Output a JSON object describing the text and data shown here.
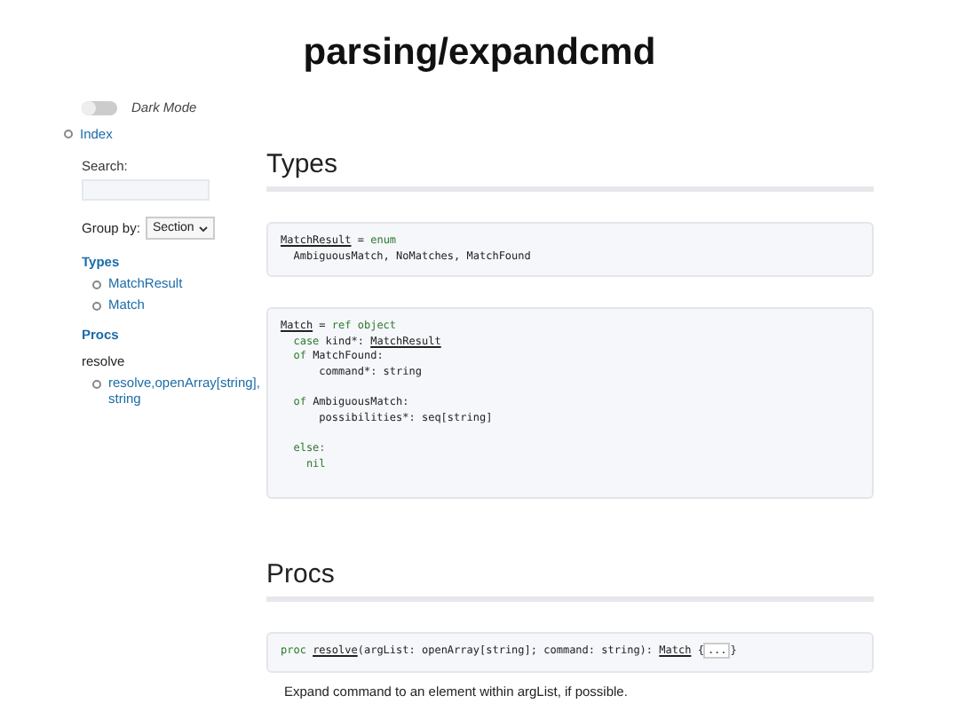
{
  "title": "parsing/expandcmd",
  "sidebar": {
    "dark_mode": {
      "label": "Dark Mode",
      "on": false
    },
    "index_link": "Index",
    "search": {
      "label": "Search:"
    },
    "group_by": {
      "label": "Group by:",
      "value": "Section"
    },
    "groups": [
      {
        "title": "Types",
        "items": [
          "MatchResult",
          "Match"
        ]
      },
      {
        "title": "Procs",
        "subtitle": "resolve",
        "items": [
          "resolve,openArray[string], string"
        ]
      }
    ]
  },
  "sections": [
    {
      "heading": "Types",
      "blocks": [
        {
          "paragraphs": [
            [
              [
                {
                  "kind": "ref",
                  "text": "MatchResult"
                },
                {
                  "kind": "plain",
                  "text": " = "
                },
                {
                  "kind": "kw",
                  "text": "enum"
                }
              ],
              [
                {
                  "kind": "plain",
                  "text": "  AmbiguousMatch, NoMatches, MatchFound"
                }
              ]
            ]
          ]
        },
        {
          "paragraphs": [
            [
              [
                {
                  "kind": "ref",
                  "text": "Match"
                },
                {
                  "kind": "plain",
                  "text": " = "
                },
                {
                  "kind": "kw",
                  "text": "ref object"
                }
              ],
              [
                {
                  "kind": "kw",
                  "text": "  case"
                },
                {
                  "kind": "plain",
                  "text": " kind*: "
                },
                {
                  "kind": "ref",
                  "text": "MatchResult"
                }
              ],
              [
                {
                  "kind": "kw",
                  "text": "  of"
                },
                {
                  "kind": "plain",
                  "text": " MatchFound:"
                }
              ],
              [
                {
                  "kind": "plain",
                  "text": "      command*: string"
                }
              ]
            ],
            [
              [
                {
                  "kind": "kw",
                  "text": "  of"
                },
                {
                  "kind": "plain",
                  "text": " AmbiguousMatch:"
                }
              ],
              [
                {
                  "kind": "plain",
                  "text": "      possibilities*: seq[string]"
                }
              ]
            ],
            [
              [
                {
                  "kind": "kw",
                  "text": "  else:"
                }
              ],
              [
                {
                  "kind": "kw",
                  "text": "    nil"
                }
              ]
            ]
          ]
        }
      ]
    },
    {
      "heading": "Procs",
      "blocks": [
        {
          "paragraphs": [
            [
              [
                {
                  "kind": "kw",
                  "text": "proc "
                },
                {
                  "kind": "ref",
                  "text": "resolve"
                },
                {
                  "kind": "plain",
                  "text": "(argList: openArray[string]; command: string): "
                },
                {
                  "kind": "ref",
                  "text": "Match"
                },
                {
                  "kind": "plain",
                  "text": " {"
                },
                {
                  "kind": "more",
                  "text": "..."
                },
                {
                  "kind": "plain",
                  "text": "}"
                }
              ]
            ]
          ]
        }
      ],
      "description": "Expand command to an element within argList, if possible."
    }
  ]
}
